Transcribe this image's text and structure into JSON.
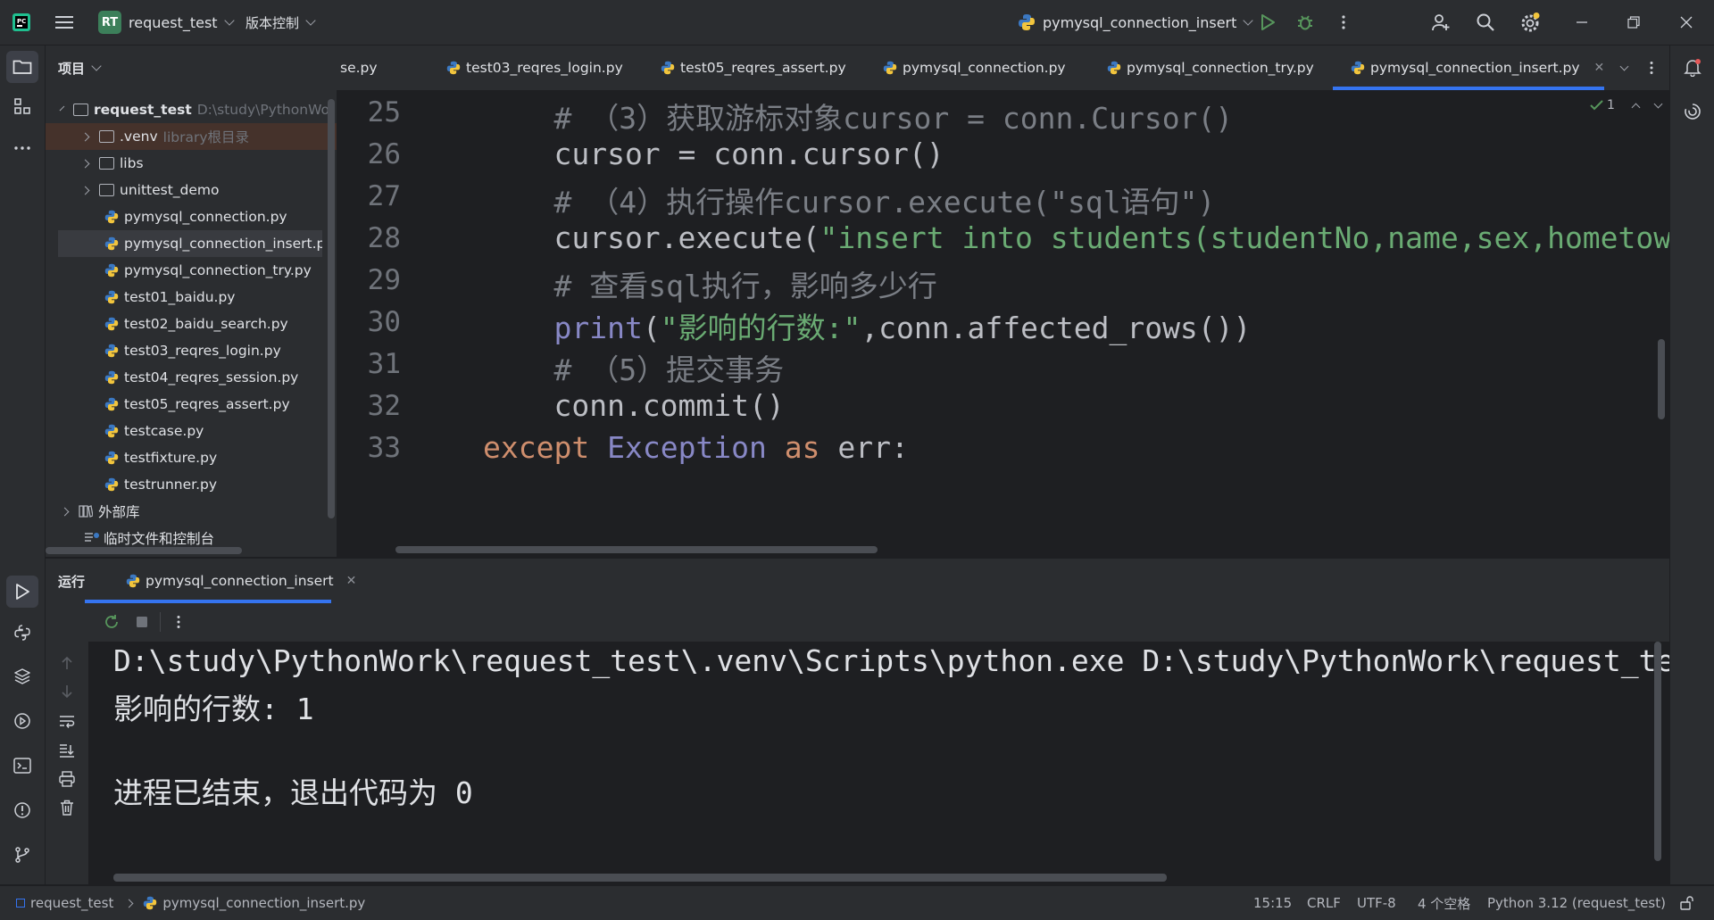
{
  "titlebar": {
    "project_badge": "RT",
    "project_name": "request_test",
    "vcs_label": "版本控制",
    "run_config": "pymysql_connection_insert"
  },
  "project_panel": {
    "title": "项目",
    "root_name": "request_test",
    "root_path": "D:\\study\\PythonWork\\",
    "items": [
      {
        "label": "request_test",
        "type": "root"
      },
      {
        "label": ".venv",
        "hint": "library根目录",
        "type": "folder"
      },
      {
        "label": "libs",
        "type": "folder"
      },
      {
        "label": "unittest_demo",
        "type": "folder"
      },
      {
        "label": "pymysql_connection.py",
        "type": "py"
      },
      {
        "label": "pymysql_connection_insert.py",
        "type": "py"
      },
      {
        "label": "pymysql_connection_try.py",
        "type": "py"
      },
      {
        "label": "test01_baidu.py",
        "type": "py"
      },
      {
        "label": "test02_baidu_search.py",
        "type": "py"
      },
      {
        "label": "test03_reqres_login.py",
        "type": "py"
      },
      {
        "label": "test04_reqres_session.py",
        "type": "py"
      },
      {
        "label": "test05_reqres_assert.py",
        "type": "py"
      },
      {
        "label": "testcase.py",
        "type": "py"
      },
      {
        "label": "testfixture.py",
        "type": "py"
      },
      {
        "label": "testrunner.py",
        "type": "py"
      },
      {
        "label": "外部库",
        "type": "lib"
      },
      {
        "label": "临时文件和控制台",
        "type": "scratch"
      }
    ]
  },
  "tabs": [
    {
      "label": "se.py"
    },
    {
      "label": "test03_reqres_login.py"
    },
    {
      "label": "test05_reqres_assert.py"
    },
    {
      "label": "pymysql_connection.py"
    },
    {
      "label": "pymysql_connection_try.py"
    },
    {
      "label": "pymysql_connection_insert.py",
      "active": true
    }
  ],
  "editor": {
    "inspection_count": "1",
    "lines": [
      {
        "num": "25",
        "parts": [
          {
            "t": "    # （3）获取游标对象cursor = conn.Cursor()",
            "c": "cmt"
          }
        ]
      },
      {
        "num": "26",
        "parts": [
          {
            "t": "    cursor = conn.cursor()",
            "c": ""
          }
        ]
      },
      {
        "num": "27",
        "parts": [
          {
            "t": "    # （4）执行操作cursor.execute(\"sql语句\")",
            "c": "cmt"
          }
        ]
      },
      {
        "num": "28",
        "parts": [
          {
            "t": "    cursor.execute(",
            "c": ""
          },
          {
            "t": "\"insert into students(studentNo,name,sex,hometown",
            "c": "str"
          }
        ]
      },
      {
        "num": "29",
        "parts": [
          {
            "t": "    # 查看sql执行，影响多少行",
            "c": "cmt"
          }
        ]
      },
      {
        "num": "30",
        "parts": [
          {
            "t": "    ",
            "c": ""
          },
          {
            "t": "print",
            "c": "bi"
          },
          {
            "t": "(",
            "c": ""
          },
          {
            "t": "\"影响的行数:\"",
            "c": "str"
          },
          {
            "t": ",conn.affected_rows())",
            "c": ""
          }
        ]
      },
      {
        "num": "31",
        "parts": [
          {
            "t": "    # （5）提交事务",
            "c": "cmt"
          }
        ]
      },
      {
        "num": "32",
        "parts": [
          {
            "t": "    conn.commit()",
            "c": ""
          }
        ]
      },
      {
        "num": "33",
        "parts": [
          {
            "t": "except",
            "c": "kw"
          },
          {
            "t": " ",
            "c": ""
          },
          {
            "t": "Exception",
            "c": "cls"
          },
          {
            "t": " ",
            "c": ""
          },
          {
            "t": "as",
            "c": "kw"
          },
          {
            "t": " err:",
            "c": ""
          }
        ]
      }
    ]
  },
  "run_panel": {
    "title": "运行",
    "tab_label": "pymysql_connection_insert",
    "output": [
      "D:\\study\\PythonWork\\request_test\\.venv\\Scripts\\python.exe D:\\study\\PythonWork\\request_test\\pymysql_connection_insert.py",
      "影响的行数: 1",
      "",
      "进程已结束，退出代码为 0"
    ]
  },
  "statusbar": {
    "project": "request_test",
    "file": "pymysql_connection_insert.py",
    "position": "15:15",
    "line_sep": "CRLF",
    "encoding": "UTF-8",
    "indent": "4 个空格",
    "interpreter": "Python 3.12 (request_test)"
  },
  "colors": {
    "accent": "#3574f0",
    "background": "#1e1f22",
    "panel": "#2b2d30"
  }
}
